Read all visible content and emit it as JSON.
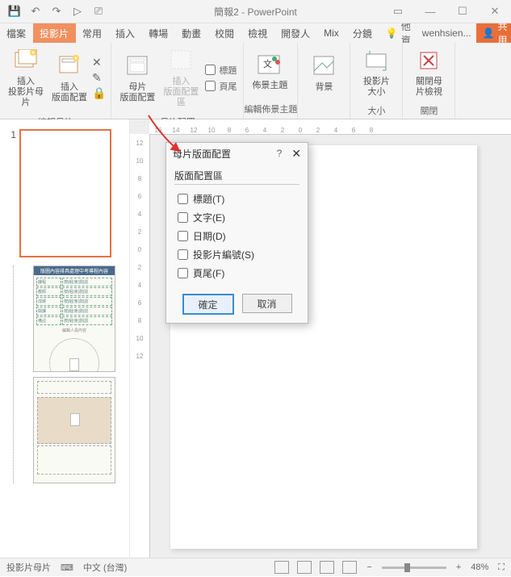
{
  "title": "簡報2 - PowerPoint",
  "qat": {
    "save": "💾",
    "undo": "↶",
    "redo": "↷",
    "start": "▷",
    "touch": "⎚"
  },
  "win": {
    "ribmin": "▭",
    "min": "—",
    "max": "☐",
    "close": "✕"
  },
  "tabs": [
    "檔案",
    "投影片",
    "常用",
    "插入",
    "轉場",
    "動畫",
    "校閱",
    "檢視",
    "開發人",
    "Mix",
    "分鏡"
  ],
  "active_tab_index": 1,
  "tellme": "其他資訊",
  "account": "wenhsien...",
  "share": "共用",
  "ribbon": {
    "g1_label": "編輯母片",
    "g1_btn1": "插入\n投影片母片",
    "g1_btn2": "插入\n版面配置",
    "g2_label": "母片配置",
    "g2_btn1": "母片\n版面配置",
    "g2_btn2": "插入\n版面配置區",
    "g2_chk1": "標題",
    "g2_chk2": "頁尾",
    "g3_label": "編輯佈景主題",
    "g3_btn1": "佈景主題",
    "g4_btn1": "背景",
    "g5_label": "大小",
    "g5_btn1": "投影片\n大小",
    "g6_label": "關閉",
    "g6_btn1": "關閉母\n片檢視"
  },
  "hruler": [
    "16",
    "14",
    "12",
    "10",
    "8",
    "6",
    "4",
    "2",
    "0",
    "2",
    "4",
    "6",
    "8"
  ],
  "vruler": [
    "12",
    "10",
    "8",
    "6",
    "4",
    "2",
    "0",
    "2",
    "4",
    "6",
    "8",
    "10",
    "12"
  ],
  "thumb_num": "1",
  "dialog": {
    "title": "母片版面配置",
    "section": "版面配置區",
    "opts": [
      "標題(T)",
      "文字(E)",
      "日期(D)",
      "投影片編號(S)",
      "頁尾(F)"
    ],
    "ok": "確定",
    "cancel": "取消"
  },
  "status": {
    "mode": "投影片母片",
    "lang_icon": "⌨",
    "lang": "中文 (台灣)",
    "zoom": "48%"
  }
}
